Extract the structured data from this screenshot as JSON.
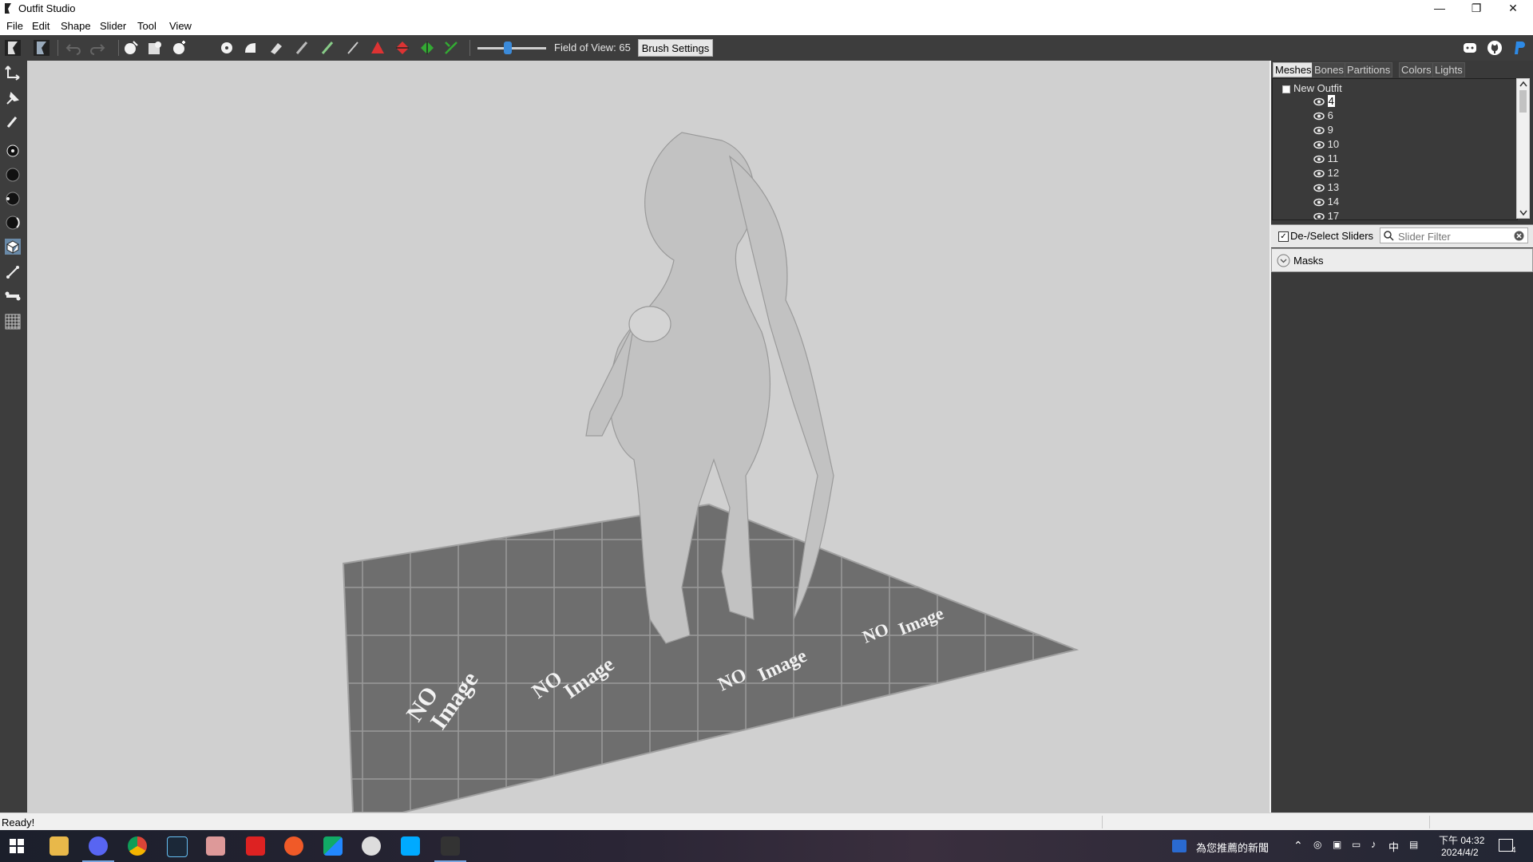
{
  "window": {
    "title": "Outfit Studio",
    "controls": {
      "minimize": "—",
      "restore": "❐",
      "close": "✕"
    }
  },
  "menu": {
    "items": [
      "File",
      "Edit",
      "Shape",
      "Slider",
      "Tool",
      "View"
    ]
  },
  "toolbar": {
    "fov_label": "Field of View: 65",
    "brush_settings": "Brush Settings"
  },
  "panel": {
    "tabs": [
      "Meshes",
      "Bones",
      "Partitions",
      "Colors",
      "Lights"
    ],
    "active_tab": "Meshes",
    "tree": {
      "root": "New Outfit",
      "items": [
        "4",
        "6",
        "9",
        "10",
        "11",
        "12",
        "13",
        "14",
        "17"
      ]
    },
    "sliders": {
      "deselect_label": "De-/Select Sliders",
      "filter_placeholder": "Slider Filter",
      "masks_label": "Masks"
    }
  },
  "viewport": {
    "floor_text_line1": "NO",
    "floor_text_line2": "Image"
  },
  "status": {
    "text": "Ready!"
  },
  "taskbar": {
    "news": "為您推薦的新聞",
    "ime": "中",
    "time": "下午 04:32",
    "date": "2024/4/2",
    "notification_count": "4"
  },
  "colors": {
    "toolbar_bg": "#3d3d3d",
    "panel_bg": "#3a3a3a",
    "viewport_bg": "#d0d0d0",
    "accent": "#3b8ad9"
  }
}
